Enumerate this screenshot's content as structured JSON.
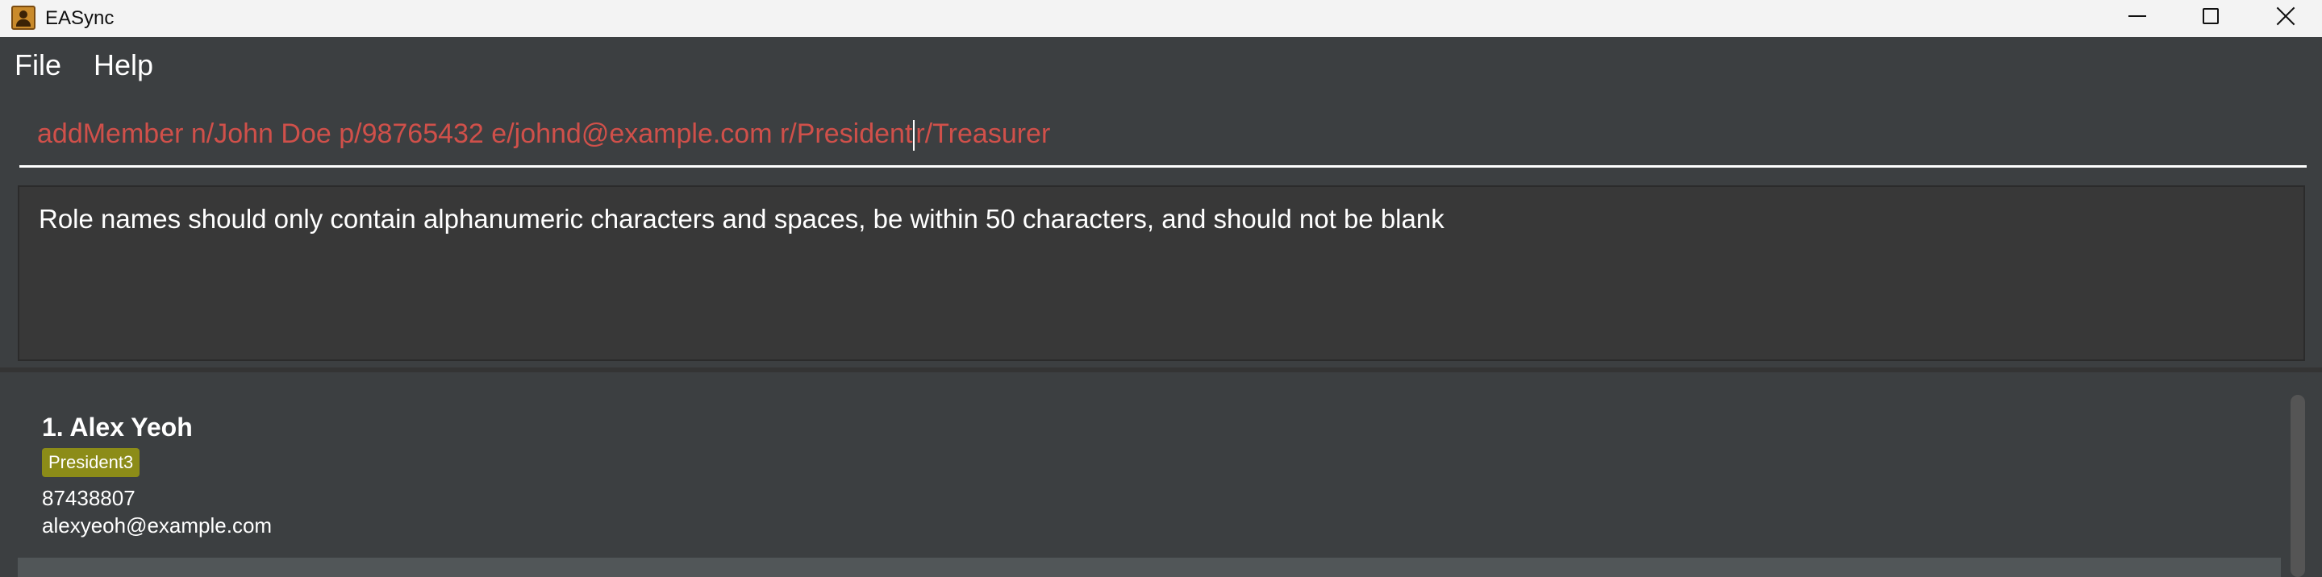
{
  "window": {
    "title": "EASync",
    "icon": "address-book-icon",
    "controls": [
      "minimize-icon",
      "maximize-icon",
      "close-icon"
    ]
  },
  "menu": {
    "items": [
      "File",
      "Help"
    ]
  },
  "command": {
    "value_before_caret": "addMember n/John Doe p/98765432 e/johnd@example.com r/President",
    "value_after_caret": "r/Treasurer",
    "text_color": "#d0504a"
  },
  "result": {
    "message": "Role names should only contain alphanumeric characters and spaces, be within 50 characters, and should not be blank"
  },
  "members": [
    {
      "name": "1. Alex Yeoh",
      "roles": [
        "President3"
      ],
      "phone": "87438807",
      "email": "alexyeoh@example.com"
    }
  ],
  "colors": {
    "background": "#3c3f41",
    "tag": "#8c8c18",
    "error_text": "#d0504a"
  }
}
